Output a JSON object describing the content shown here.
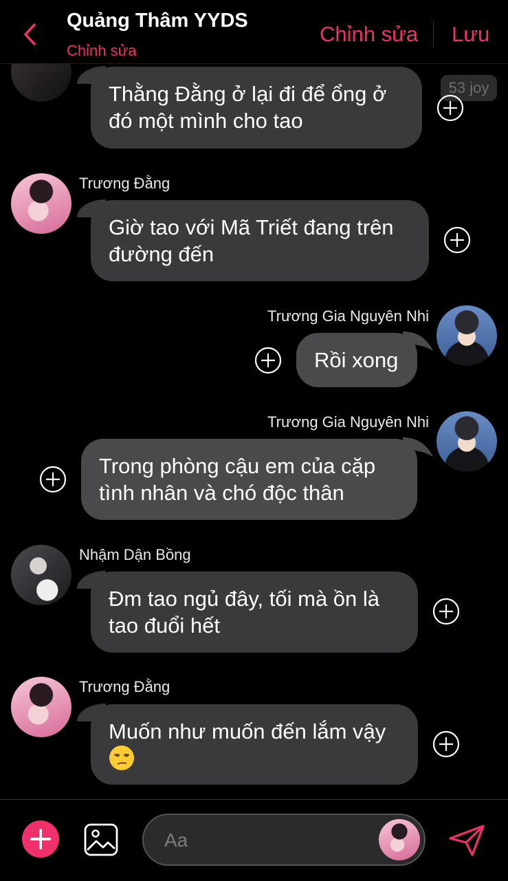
{
  "header": {
    "title": "Quảng Thâm YYDS",
    "subtitle": "Chỉnh sửa",
    "edit_label": "Chỉnh sửa",
    "save_label": "Lưu"
  },
  "reaction_badge": "53 joy",
  "messages": [
    {
      "sender": "",
      "text": "Thằng Đằng ở lại đi để ổng ở đó một mình cho tao",
      "side": "left"
    },
    {
      "sender": "Trương Đằng",
      "text": "Giờ tao với Mã Triết đang trên đường đến",
      "side": "left"
    },
    {
      "sender": "Trương Gia Nguyên Nhi",
      "text": "Rồi xong",
      "side": "right"
    },
    {
      "sender": "Trương Gia Nguyên Nhi",
      "text": "Trong phòng cậu em của cặp tình nhân và chó độc thân",
      "side": "right"
    },
    {
      "sender": "Nhậm Dận Bồng",
      "text": "Đm tao ngủ đây, tối mà ồn là tao đuổi hết",
      "side": "left"
    },
    {
      "sender": "Trương Đằng",
      "text": "Muốn như muốn đến lắm vậy",
      "side": "left",
      "emoji": "unamused-face-icon"
    }
  ],
  "composer": {
    "placeholder": "Aa"
  },
  "colors": {
    "accent": "#f0306b",
    "bubble": "#3a3a3c",
    "background": "#000000"
  }
}
